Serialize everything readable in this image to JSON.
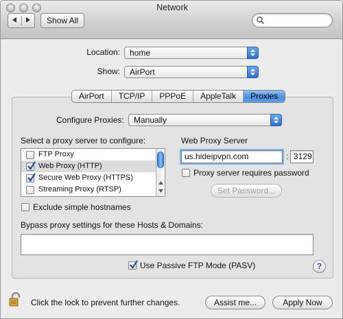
{
  "window": {
    "title": "Network"
  },
  "toolbar": {
    "show_all_label": "Show All",
    "search_placeholder": ""
  },
  "location": {
    "label": "Location:",
    "value": "home"
  },
  "show": {
    "label": "Show:",
    "value": "AirPort"
  },
  "tabs": [
    {
      "label": "AirPort",
      "active": false
    },
    {
      "label": "TCP/IP",
      "active": false
    },
    {
      "label": "PPPoE",
      "active": false
    },
    {
      "label": "AppleTalk",
      "active": false
    },
    {
      "label": "Proxies",
      "active": true
    }
  ],
  "configure": {
    "label": "Configure Proxies:",
    "value": "Manually"
  },
  "proxy_list": {
    "label": "Select a proxy server to configure:",
    "items": [
      {
        "label": "FTP Proxy",
        "checked": false,
        "selected": false
      },
      {
        "label": "Web Proxy (HTTP)",
        "checked": true,
        "selected": true
      },
      {
        "label": "Secure Web Proxy (HTTPS)",
        "checked": true,
        "selected": false
      },
      {
        "label": "Streaming Proxy (RTSP)",
        "checked": false,
        "selected": false
      }
    ]
  },
  "server": {
    "label": "Web Proxy Server",
    "host": "us.hideipvpn.com",
    "colon": ":",
    "port": "3129",
    "password_required_label": "Proxy server requires password",
    "set_password_label": "Set Password..."
  },
  "exclude_label": "Exclude simple hostnames",
  "bypass_label": "Bypass proxy settings for these Hosts & Domains:",
  "bypass_value": "",
  "passive_ftp_label": "Use Passive FTP Mode (PASV)",
  "help_label": "?",
  "footer": {
    "lock_text": "Click the lock to prevent further changes.",
    "assist_label": "Assist me...",
    "apply_label": "Apply Now"
  },
  "colors": {
    "accent": "#4d8fdf",
    "check": "#1f4fa0"
  }
}
